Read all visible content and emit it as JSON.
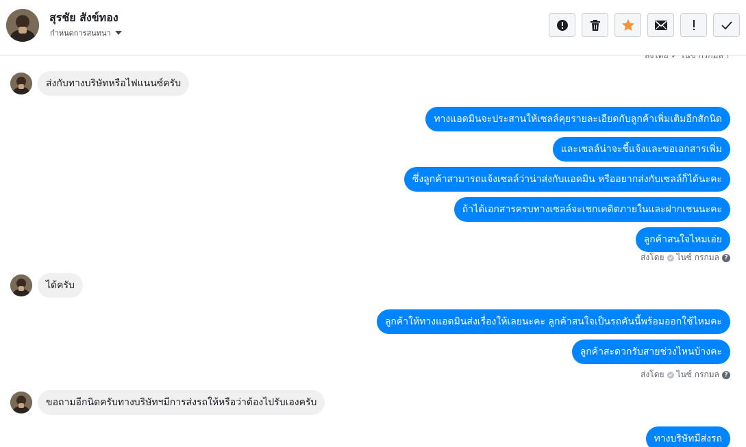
{
  "header": {
    "contact_name": "สุรชัย สังข์ทอง",
    "assign_label": "กำหนดการสนทนา",
    "toolbar": {
      "icons": [
        "alert-circle-icon",
        "trash-icon",
        "star-icon",
        "envelope-icon",
        "exclamation-icon",
        "checkmark-icon"
      ],
      "star_color": "#f7923b"
    }
  },
  "colors": {
    "outgoing_bubble": "#0084ff",
    "incoming_bubble": "#f1f0f0"
  },
  "conversation": {
    "top_cut_meta": "ส่งโดย ✓ ไนซ์ กรกมล ?",
    "incoming_1": "ส่งกับทางบริษัทหรือไฟแนนซ์ครับ",
    "outgoing_1": [
      "ทางแอดมินจะประสานให้เซลล์คุยรายละเอียดกับลูกค้าเพิ่มเติมอีกสักนิด",
      "และเซลล์น่าจะชี้แจ้งและขอเอกสารเพิ่ม",
      "ซึ่งลูกค้าสามารถแจ้งเซลล์ว่าน่าส่งกับแอดมิน หรืออยากส่งกับเซลล์ก็ได้นะคะ",
      "ถ้าได้เอกสารครบทางเซลล์จะเชกเคดิตภายในและฝากเชนนะคะ",
      "ลูกค้าสนใจไหมเอ่ย"
    ],
    "sent_meta_1": {
      "prefix": "ส่งโดย",
      "agent": "ไนซ์ กรกมล",
      "help": "?"
    },
    "incoming_2": "ได้ครับ",
    "outgoing_2": [
      "ลูกค้าให้ทางแอดมินส่งเรื่องให้เลยนะคะ ลูกค้าสนใจเป็นรถคันนี้พร้อมออกใช้ไหมคะ",
      "ลูกค้าสะดวกรับสายช่วงไหนบ้างคะ"
    ],
    "sent_meta_2": {
      "prefix": "ส่งโดย",
      "agent": "ไนซ์ กรกมล",
      "help": "?"
    },
    "incoming_3": "ขอถามอีกนิดครับทางบริษัทฯมีการส่งรถให้หรือว่าต้องไปรับเองครับ",
    "outgoing_3": [
      "ทางบริษัทมีส่งรถ"
    ]
  }
}
